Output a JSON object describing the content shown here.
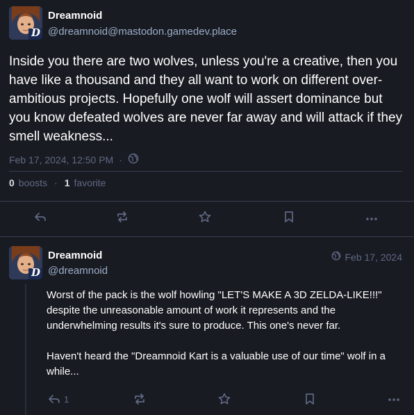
{
  "main_post": {
    "display_name": "Dreamnoid",
    "account": "@dreamnoid@mastodon.gamedev.place",
    "content": "Inside you there are two wolves, unless you're a creative, then you have like a thousand and they all want to work on different over-ambitious projects. Hopefully one wolf will assert dominance but you know defeated wolves are never far away and will attack if they smell weakness...",
    "timestamp": "Feb 17, 2024, 12:50 PM",
    "separator": "·",
    "visibility_icon": "globe-icon",
    "boosts_count": "0",
    "boosts_label": "boosts",
    "favorites_count": "1",
    "favorites_label": "favorite"
  },
  "reply": {
    "display_name": "Dreamnoid",
    "account": "@dreamnoid",
    "timestamp": "Feb 17, 2024",
    "visibility_icon": "globe-icon",
    "paragraphs": [
      "Worst of the pack is the wolf howling \"LET'S MAKE A 3D ZELDA-LIKE!!!\" despite the unreasonable amount of work it represents and the underwhelming results it's sure to produce. This one's never far.",
      "Haven't heard the \"Dreamnoid Kart is a valuable use of our time\" wolf in a while..."
    ],
    "reply_count": "1"
  },
  "avatar_badge": "D",
  "colors": {
    "background": "#191b22",
    "text": "#ffffff",
    "secondary_text": "#9baec8",
    "muted": "#606984",
    "divider": "#393f4f"
  }
}
